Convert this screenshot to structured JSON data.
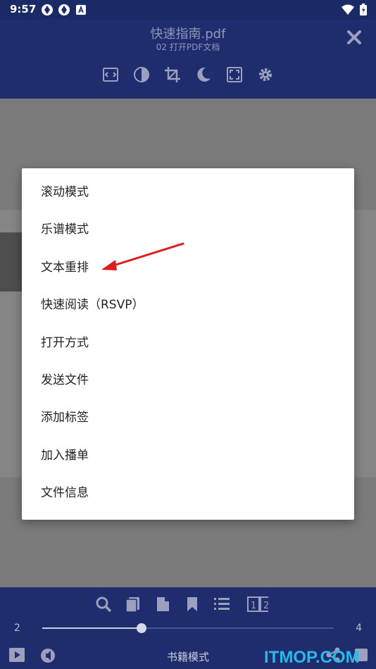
{
  "status_bar": {
    "time": "9:57"
  },
  "header": {
    "title": "快速指南.pdf",
    "subtitle": "02 打开PDF文档",
    "tools": [
      {
        "name": "fit-width-icon"
      },
      {
        "name": "contrast-icon",
        "active": true
      },
      {
        "name": "crop-icon"
      },
      {
        "name": "night-mode-icon"
      },
      {
        "name": "fullscreen-icon"
      },
      {
        "name": "settings-gear-icon"
      }
    ]
  },
  "menu": {
    "items": [
      "滚动模式",
      "乐谱模式",
      "文本重排",
      "快速阅读（RSVP）",
      "打开方式",
      "发送文件",
      "添加标签",
      "加入播单",
      "文件信息"
    ],
    "highlight_arrow_target": "文本重排"
  },
  "footer": {
    "page_min": "2",
    "page_max": "4",
    "progress": 0.34,
    "mode_label": "书籍模式",
    "watermark": "ITMOP.COM"
  },
  "colors": {
    "toolbar_bg": "#1f2d6e",
    "arrow": "#d81e1e",
    "watermark": "#29b8e8"
  }
}
